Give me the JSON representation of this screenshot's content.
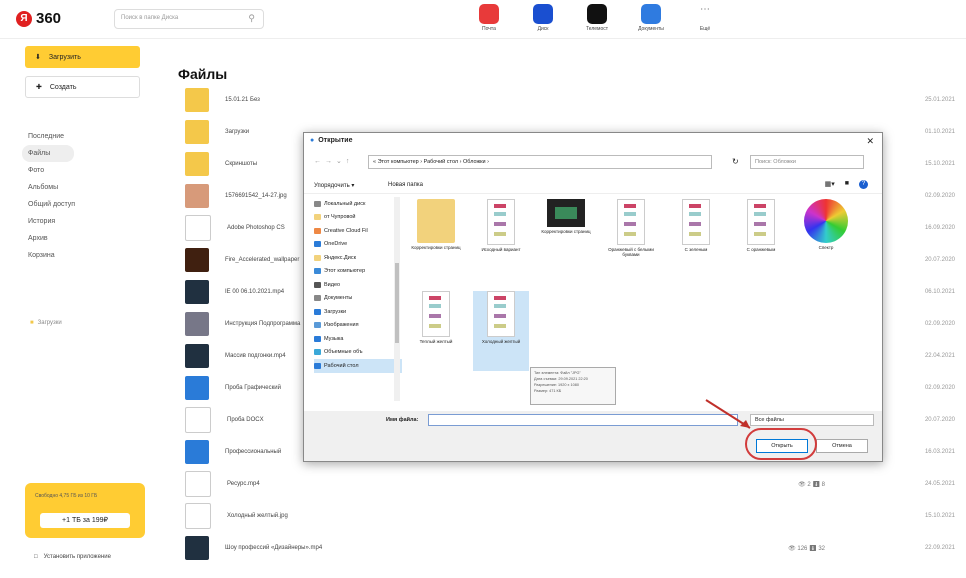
{
  "header": {
    "logo_letter": "Я",
    "logo_text": "360",
    "search_placeholder": "Поиск в папке Диска",
    "apps": [
      {
        "label": "Почта",
        "color": "#e83a3a"
      },
      {
        "label": "Диск",
        "color": "#1a4fd0"
      },
      {
        "label": "Телемост",
        "color": "#111111"
      },
      {
        "label": "Документы",
        "color": "#2f7be0"
      },
      {
        "label": "Ещё",
        "color": "#ffffff"
      }
    ]
  },
  "sidebar": {
    "upload_label": "Загрузить",
    "create_label": "Создать",
    "items": [
      "Последние",
      "Файлы",
      "Фото",
      "Альбомы",
      "Общий доступ",
      "История",
      "Архив",
      "Корзина"
    ],
    "upload_folder": "Загрузки",
    "promo_free": "Свободно 4,75 ГБ из 10 ГБ",
    "promo_button": "+1 ТБ за 199₽",
    "install_app": "Установить приложение"
  },
  "main": {
    "title": "Файлы",
    "files": [
      {
        "name": "15.01.21 Без",
        "date": "25.01.2021",
        "thumb": "folder",
        "stats": ""
      },
      {
        "name": "Загрузки",
        "date": "01.10.2021",
        "thumb": "folder",
        "stats": ""
      },
      {
        "name": "Скриншоты",
        "date": "15.10.2021",
        "thumb": "folder-shot",
        "stats": ""
      },
      {
        "name": "1576691542_14-27.jpg",
        "date": "02.09.2020",
        "thumb": "photo",
        "stats": ""
      },
      {
        "name": "Adobe Photoshop CS",
        "date": "16.09.2020",
        "thumb": "app",
        "stats": ""
      },
      {
        "name": "Fire_Accelerated_wallpaper",
        "date": "20.07.2020",
        "thumb": "fire",
        "stats": ""
      },
      {
        "name": "IE 00 06.10.2021.mp4",
        "date": "06.10.2021",
        "thumb": "dark",
        "stats": ""
      },
      {
        "name": "Инструкция Подпрограмма",
        "date": "02.09.2020",
        "thumb": "gray",
        "stats": ""
      },
      {
        "name": "Массив подгонки.mp4",
        "date": "22.04.2021",
        "thumb": "dark",
        "stats": ""
      },
      {
        "name": "Проба Графический",
        "date": "02.09.2020",
        "thumb": "blue",
        "stats": ""
      },
      {
        "name": "Проба DOCX",
        "date": "20.07.2020",
        "thumb": "doc",
        "stats": ""
      },
      {
        "name": "Профессиональный",
        "date": "16.03.2021",
        "thumb": "blue",
        "stats": ""
      },
      {
        "name": "Ресурс.mp4",
        "date": "24.05.2021",
        "thumb": "doc",
        "stats": "👁 2    ⬇ 8"
      },
      {
        "name": "Холодный желтый.jpg",
        "date": "15.10.2021",
        "thumb": "doc",
        "stats": ""
      },
      {
        "name": "Шоу профессий «Дизайнеры».mp4",
        "date": "22.09.2021",
        "thumb": "dark",
        "stats": "👁 126    ⬇ 32"
      }
    ]
  },
  "dialog": {
    "title": "Открытие",
    "address": "« Этот компьютер › Рабочий стол › Обложки ›",
    "search_placeholder": "Поиск: Обложки",
    "organize": "Упорядочить ▾",
    "new_folder": "Новая папка",
    "tree": [
      {
        "label": "Локальный диск",
        "color": "#888"
      },
      {
        "label": "от Чупровой",
        "color": "#f2d27c"
      },
      {
        "label": "Creative Cloud Fil",
        "color": "#e84"
      },
      {
        "label": "OneDrive",
        "color": "#2a7bd8"
      },
      {
        "label": "Яндекс.Диск",
        "color": "#f2d27c"
      },
      {
        "label": "Этот компьютер",
        "color": "#3a8ad8"
      },
      {
        "label": "Видео",
        "color": "#555"
      },
      {
        "label": "Документы",
        "color": "#888"
      },
      {
        "label": "Загрузки",
        "color": "#2a7bd8"
      },
      {
        "label": "Изображения",
        "color": "#5a9ad8"
      },
      {
        "label": "Музыка",
        "color": "#2a7bd8"
      },
      {
        "label": "Объемные объ",
        "color": "#3aa8d8"
      },
      {
        "label": "Рабочий стол",
        "color": "#2a7bd8"
      }
    ],
    "files": [
      {
        "label": "Корректировки страниц",
        "kind": "folder"
      },
      {
        "label": "Исходный вариант",
        "kind": "doc"
      },
      {
        "label": "Корректировки страниц",
        "kind": "video"
      },
      {
        "label": "Оранжевый с белыми буквами",
        "kind": "doc"
      },
      {
        "label": "С зеленым",
        "kind": "doc"
      },
      {
        "label": "С оранжевым",
        "kind": "doc"
      },
      {
        "label": "Спектр",
        "kind": "wheel"
      },
      {
        "label": "Теплый желтый",
        "kind": "doc"
      },
      {
        "label": "Холодный желтый",
        "kind": "doc"
      }
    ],
    "tooltip": "Тип элемента: Файл \"JPG\"\nДата съемки: 29.09.2021 22:20\nРазрешение: 1920 x 1080\nРазмер: 471 КБ",
    "filename_label": "Имя файла:",
    "filter": "Все файлы",
    "open": "Открыть",
    "cancel": "Отмена"
  }
}
